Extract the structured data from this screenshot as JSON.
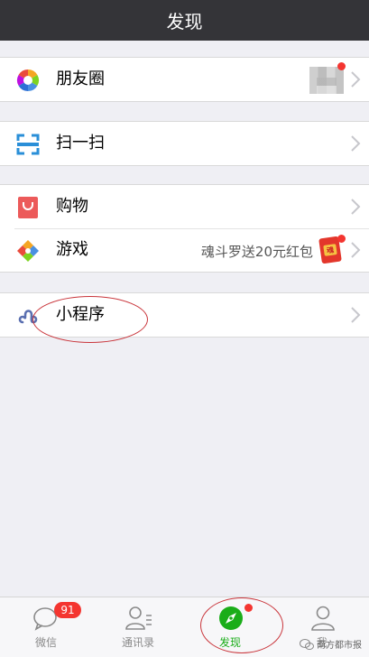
{
  "header": {
    "title": "发现"
  },
  "groups": [
    {
      "items": [
        {
          "label": "朋友圈",
          "icon": "moments-icon"
        }
      ]
    },
    {
      "items": [
        {
          "label": "扫一扫",
          "icon": "scan-icon"
        }
      ]
    },
    {
      "items": [
        {
          "label": "购物",
          "icon": "shopping-icon"
        },
        {
          "label": "游戏",
          "icon": "games-icon",
          "extra": "魂斗罗送20元红包"
        }
      ]
    },
    {
      "items": [
        {
          "label": "小程序",
          "icon": "mini-program-icon"
        }
      ]
    }
  ],
  "tabbar": {
    "tabs": [
      {
        "label": "微信",
        "icon": "chat-bubble-icon",
        "badge": "91"
      },
      {
        "label": "通讯录",
        "icon": "contacts-icon"
      },
      {
        "label": "发现",
        "icon": "compass-icon",
        "active": true
      },
      {
        "label": "我",
        "icon": "person-icon"
      }
    ]
  },
  "redpacket": {
    "text": "魂"
  },
  "watermark": {
    "text": "南方都市报"
  },
  "colors": {
    "header": "#343438",
    "accent_green": "#1aad19",
    "badge_red": "#f43530",
    "annotation_red": "#c9343a"
  }
}
